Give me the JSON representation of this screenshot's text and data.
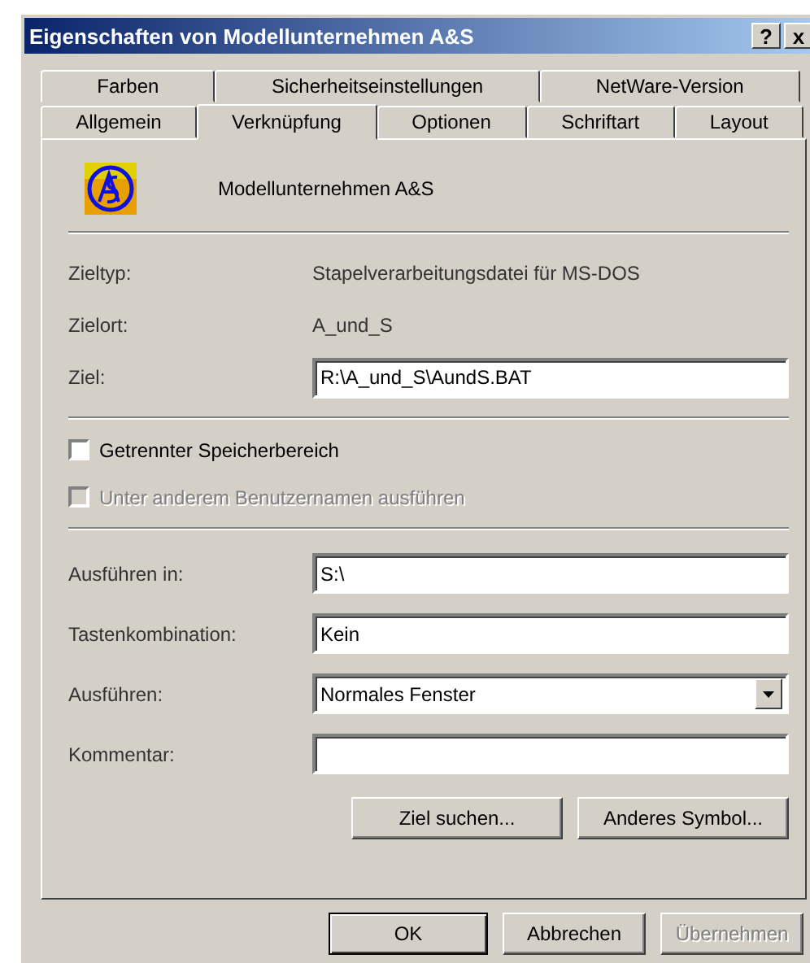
{
  "window": {
    "title": "Eigenschaften von Modellunternehmen A&S",
    "help_button": "?",
    "close_button": "x"
  },
  "tabs": [
    [
      {
        "label": "Farben",
        "selected": false
      },
      {
        "label": "Sicherheitseinstellungen",
        "selected": false
      },
      {
        "label": "NetWare-Version",
        "selected": false
      }
    ],
    [
      {
        "label": "Allgemein",
        "selected": false
      },
      {
        "label": "Verknüpfung",
        "selected": true
      },
      {
        "label": "Optionen",
        "selected": false
      },
      {
        "label": "Schriftart",
        "selected": false
      },
      {
        "label": "Layout",
        "selected": false
      }
    ]
  ],
  "header": {
    "name": "Modellunternehmen A&S"
  },
  "info": [
    {
      "label": "Zieltyp:",
      "value": "Stapelverarbeitungsdatei für MS-DOS"
    },
    {
      "label": "Zielort:",
      "value": "A_und_S"
    }
  ],
  "target": {
    "label": "Ziel:",
    "value": "R:\\A_und_S\\AundS.BAT"
  },
  "options": [
    {
      "label": "Getrennter Speicherbereich",
      "checked": false,
      "disabled": false
    },
    {
      "label": "Unter anderem Benutzernamen ausführen",
      "checked": false,
      "disabled": true
    }
  ],
  "fields": [
    {
      "kind": "text",
      "label": "Ausführen in:",
      "value": "S:\\"
    },
    {
      "kind": "text",
      "label": "Tastenkombination:",
      "value": "Kein"
    },
    {
      "kind": "select",
      "label": "Ausführen:",
      "value": "Normales Fenster"
    },
    {
      "kind": "text",
      "label": "Kommentar:"
    }
  ],
  "actions": [
    {
      "label": "Ziel suchen..."
    },
    {
      "label": "Anderes Symbol..."
    }
  ],
  "footer": [
    {
      "label": "OK",
      "default": true,
      "disabled": false
    },
    {
      "label": "Abbrechen",
      "default": false,
      "disabled": false
    },
    {
      "label": "Übernehmen",
      "default": false,
      "disabled": true
    }
  ]
}
